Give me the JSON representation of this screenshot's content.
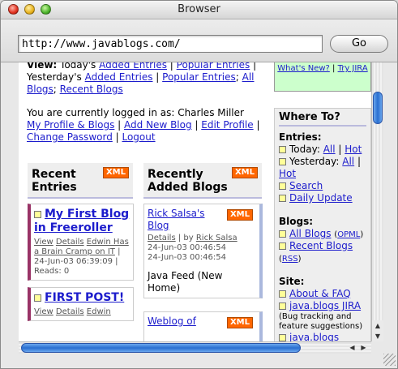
{
  "window": {
    "title": "Browser"
  },
  "toolbar": {
    "url": "http://www.javablogs.com/",
    "go_label": "Go"
  },
  "page": {
    "view_prefix": "View:",
    "view_today": "Today's",
    "today_added": "Added Entries",
    "today_popular": "Popular Entries",
    "yesterday_label": "Yesterday's",
    "yesterday_added": "Added Entries",
    "yesterday_popular": "Popular Entries",
    "all_blogs": "All Blogs",
    "recent_blogs": "Recent Blogs",
    "logged_in": "You are currently logged in as: Charles Miller",
    "profile_links": [
      "My Profile & Blogs",
      "Add New Blog",
      "Edit Profile",
      "Change Password",
      "Logout"
    ],
    "recent_entries": {
      "heading": "Recent Entries",
      "xml": "XML",
      "items": [
        {
          "title": "My First Blog in Freeroller",
          "view": "View",
          "details": "Details",
          "author": "Edwin Has a Brain Cramp on IT",
          "date": "24-Jun-03 06:39:09",
          "reads": "Reads: 0"
        },
        {
          "title": "FIRST POST!",
          "view": "View",
          "details": "Details",
          "author": "Edwin"
        }
      ]
    },
    "recent_blogs_col": {
      "heading": "Recently Added Blogs",
      "xml": "XML",
      "items": [
        {
          "title": "Rick Salsa's Blog",
          "xml": "XML",
          "details": "Details",
          "by": "by",
          "author": "Rick Salsa",
          "date1": "24-Jun-03 00:46:54",
          "date2": "24-Jun-03 00:46:54",
          "desc": "Java Feed (New Home)"
        },
        {
          "title": "Weblog of",
          "xml": "XML"
        }
      ]
    },
    "sidebar": {
      "whats_new": "What's New?",
      "try_jira": "Try JIRA",
      "heading": "Where To?",
      "entries_label": "Entries:",
      "today": "Today:",
      "all": "All",
      "hot": "Hot",
      "yesterday": "Yesterday:",
      "search": "Search",
      "daily_update": "Daily Update",
      "blogs_label": "Blogs:",
      "all_blogs": "All Blogs",
      "opml": "OPML",
      "recent_blogs": "Recent Blogs",
      "rss": "RSS",
      "site_label": "Site:",
      "about": "About & FAQ",
      "jira": "java.blogs JIRA",
      "jira_note": "(Bug tracking and feature suggestions)",
      "javablogs": "java.blogs"
    }
  }
}
